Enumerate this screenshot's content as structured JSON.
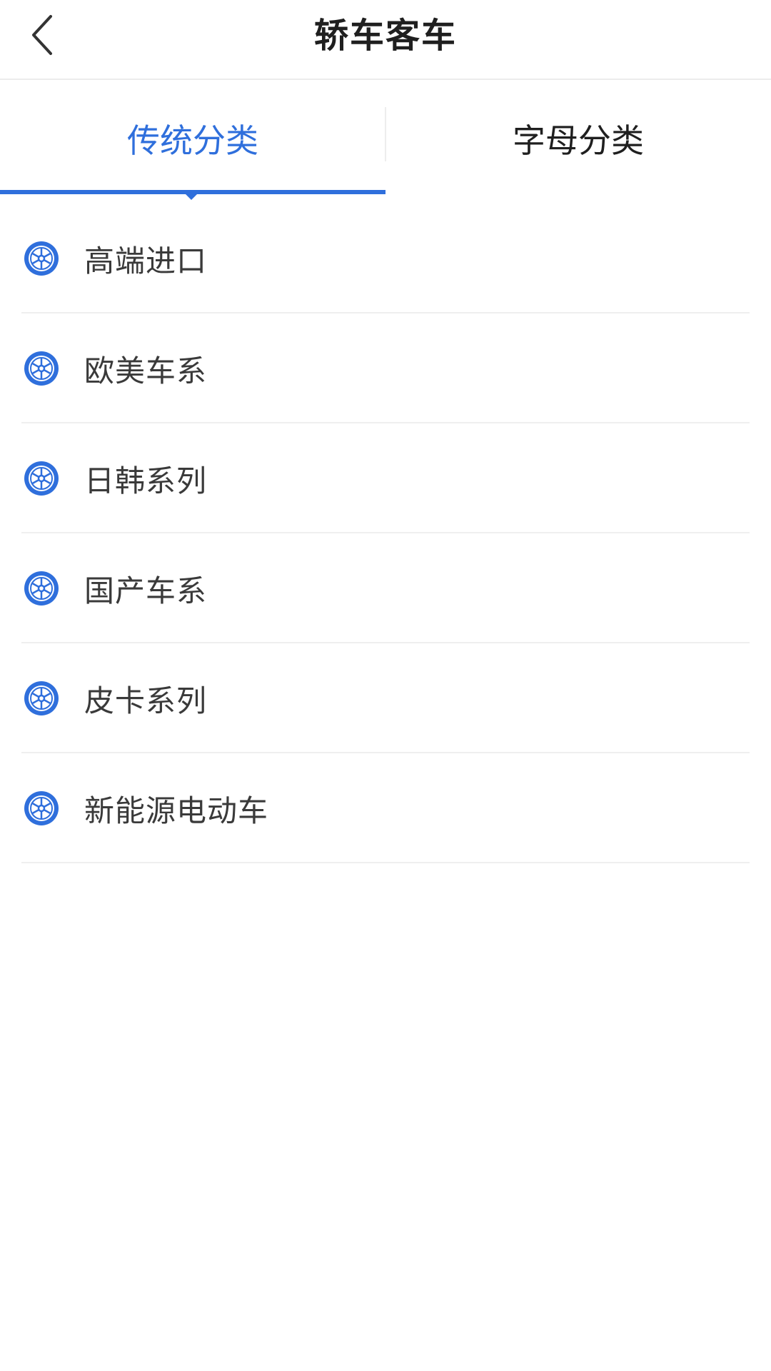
{
  "header": {
    "title": "轿车客车",
    "back_icon": "chevron-left-icon"
  },
  "tabs": [
    {
      "label": "传统分类",
      "active": true
    },
    {
      "label": "字母分类",
      "active": false
    }
  ],
  "categories": [
    {
      "label": "高端进口",
      "icon": "wheel-icon"
    },
    {
      "label": "欧美车系",
      "icon": "wheel-icon"
    },
    {
      "label": "日韩系列",
      "icon": "wheel-icon"
    },
    {
      "label": "国产车系",
      "icon": "wheel-icon"
    },
    {
      "label": "皮卡系列",
      "icon": "wheel-icon"
    },
    {
      "label": "新能源电动车",
      "icon": "wheel-icon"
    }
  ],
  "colors": {
    "accent": "#2f6fdc",
    "text": "#3a3a3a",
    "title": "#1f1f1f",
    "divider": "#efefef"
  }
}
